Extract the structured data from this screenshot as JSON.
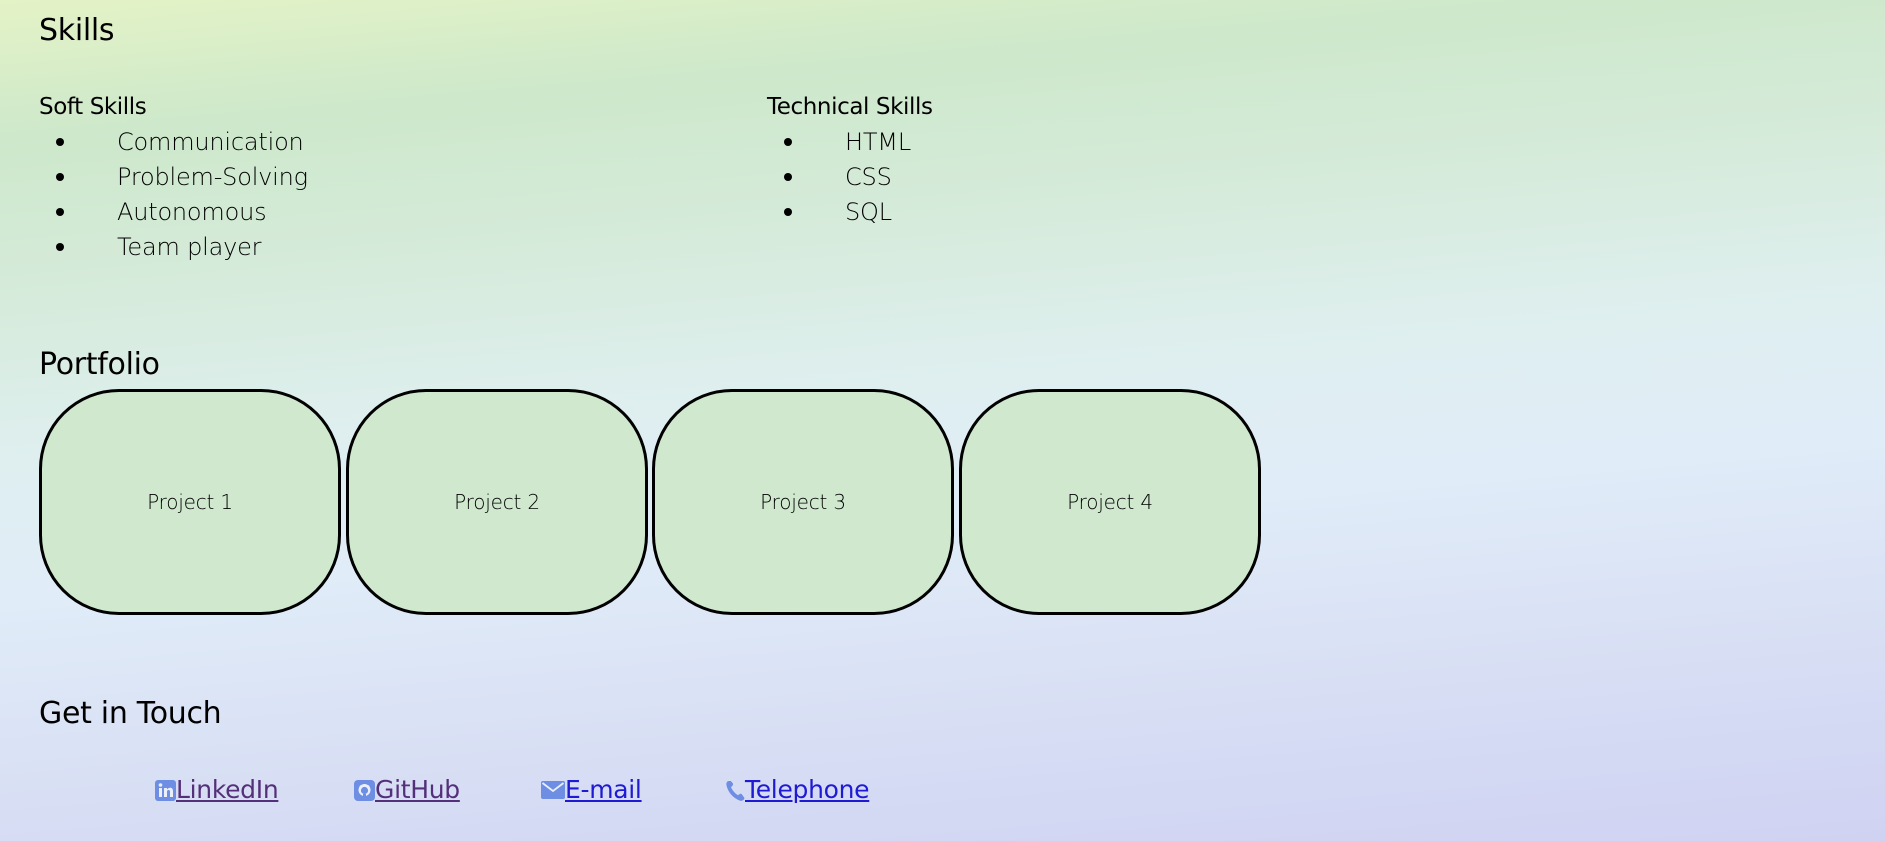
{
  "skills": {
    "title": "Skills",
    "soft": {
      "title": "Soft Skills",
      "items": [
        "Communication",
        "Problem-Solving",
        "Autonomous",
        "Team player"
      ]
    },
    "technical": {
      "title": "Technical Skills",
      "items": [
        "HTML",
        "CSS",
        "SQL"
      ]
    }
  },
  "portfolio": {
    "title": "Portfolio",
    "projects": [
      "Project 1",
      "Project 2",
      "Project 3",
      "Project 4"
    ]
  },
  "contact": {
    "title": "Get in Touch",
    "links": [
      {
        "label": "LinkedIn",
        "icon": "linkedin-icon",
        "state": "visited"
      },
      {
        "label": "GitHub",
        "icon": "github-icon",
        "state": "visited"
      },
      {
        "label": "E-mail",
        "icon": "mail-icon",
        "state": "unvisited"
      },
      {
        "label": "Telephone",
        "icon": "phone-icon",
        "state": "unvisited"
      }
    ]
  },
  "colors": {
    "card_fill": "#cfe8ce",
    "card_border": "#000000",
    "link_visited": "#55307a",
    "link_unvisited": "#1f1ad3",
    "icon": "#6e8ee3",
    "bg_top": "#e4f3c6",
    "bg_bottom": "#d0d2f2"
  }
}
